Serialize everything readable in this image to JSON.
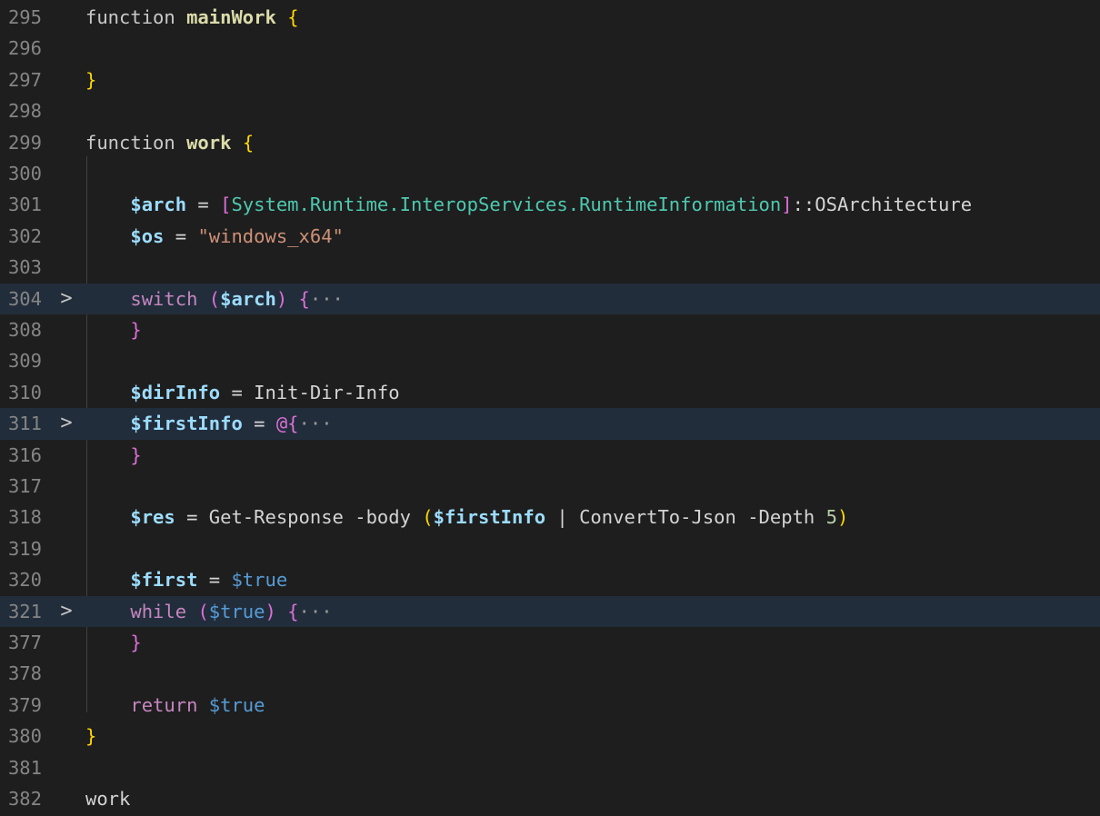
{
  "editor": {
    "lines": [
      {
        "num": "295",
        "fold": false,
        "hl": false,
        "tokens": [
          {
            "t": "function ",
            "c": "fn-kw"
          },
          {
            "t": "mainWork",
            "c": "fn"
          },
          {
            "t": " ",
            "c": "plain"
          },
          {
            "t": "{",
            "c": "brace1"
          }
        ]
      },
      {
        "num": "296",
        "fold": false,
        "hl": false,
        "tokens": []
      },
      {
        "num": "297",
        "fold": false,
        "hl": false,
        "tokens": [
          {
            "t": "}",
            "c": "brace1"
          }
        ]
      },
      {
        "num": "298",
        "fold": false,
        "hl": false,
        "tokens": []
      },
      {
        "num": "299",
        "fold": false,
        "hl": false,
        "tokens": [
          {
            "t": "function ",
            "c": "fn-kw"
          },
          {
            "t": "work",
            "c": "fn"
          },
          {
            "t": " ",
            "c": "plain"
          },
          {
            "t": "{",
            "c": "brace1"
          }
        ]
      },
      {
        "num": "300",
        "fold": false,
        "hl": false,
        "tokens": []
      },
      {
        "num": "301",
        "fold": false,
        "hl": false,
        "tokens": [
          {
            "t": "    ",
            "c": "plain"
          },
          {
            "t": "$arch",
            "c": "var"
          },
          {
            "t": " = ",
            "c": "plain"
          },
          {
            "t": "[",
            "c": "brace2"
          },
          {
            "t": "System.Runtime.InteropServices.RuntimeInformation",
            "c": "type"
          },
          {
            "t": "]",
            "c": "brace2"
          },
          {
            "t": "::OSArchitecture",
            "c": "plain"
          }
        ]
      },
      {
        "num": "302",
        "fold": false,
        "hl": false,
        "tokens": [
          {
            "t": "    ",
            "c": "plain"
          },
          {
            "t": "$os",
            "c": "var"
          },
          {
            "t": " = ",
            "c": "plain"
          },
          {
            "t": "\"windows_x64\"",
            "c": "str"
          }
        ]
      },
      {
        "num": "303",
        "fold": false,
        "hl": false,
        "tokens": []
      },
      {
        "num": "304",
        "fold": true,
        "hl": true,
        "tokens": [
          {
            "t": "    ",
            "c": "plain"
          },
          {
            "t": "switch",
            "c": "kw"
          },
          {
            "t": " ",
            "c": "plain"
          },
          {
            "t": "(",
            "c": "brace2"
          },
          {
            "t": "$arch",
            "c": "var"
          },
          {
            "t": ")",
            "c": "brace2"
          },
          {
            "t": " ",
            "c": "plain"
          },
          {
            "t": "{",
            "c": "brace2"
          },
          {
            "t": "···",
            "c": "ellip"
          }
        ]
      },
      {
        "num": "308",
        "fold": false,
        "hl": false,
        "tokens": [
          {
            "t": "    ",
            "c": "plain"
          },
          {
            "t": "}",
            "c": "brace2"
          }
        ]
      },
      {
        "num": "309",
        "fold": false,
        "hl": false,
        "tokens": []
      },
      {
        "num": "310",
        "fold": false,
        "hl": false,
        "tokens": [
          {
            "t": "    ",
            "c": "plain"
          },
          {
            "t": "$dirInfo",
            "c": "var"
          },
          {
            "t": " = Init-Dir-Info",
            "c": "plain"
          }
        ]
      },
      {
        "num": "311",
        "fold": true,
        "hl": true,
        "tokens": [
          {
            "t": "    ",
            "c": "plain"
          },
          {
            "t": "$firstInfo",
            "c": "var"
          },
          {
            "t": " = ",
            "c": "plain"
          },
          {
            "t": "@{",
            "c": "brace2"
          },
          {
            "t": "···",
            "c": "ellip"
          }
        ]
      },
      {
        "num": "316",
        "fold": false,
        "hl": false,
        "tokens": [
          {
            "t": "    ",
            "c": "plain"
          },
          {
            "t": "}",
            "c": "brace2"
          }
        ]
      },
      {
        "num": "317",
        "fold": false,
        "hl": false,
        "tokens": []
      },
      {
        "num": "318",
        "fold": false,
        "hl": false,
        "tokens": [
          {
            "t": "    ",
            "c": "plain"
          },
          {
            "t": "$res",
            "c": "var"
          },
          {
            "t": " = Get-Response -body ",
            "c": "plain"
          },
          {
            "t": "(",
            "c": "brace1"
          },
          {
            "t": "$firstInfo",
            "c": "var"
          },
          {
            "t": " | ConvertTo-Json -Depth ",
            "c": "plain"
          },
          {
            "t": "5",
            "c": "num"
          },
          {
            "t": ")",
            "c": "brace1"
          }
        ]
      },
      {
        "num": "319",
        "fold": false,
        "hl": false,
        "tokens": []
      },
      {
        "num": "320",
        "fold": false,
        "hl": false,
        "tokens": [
          {
            "t": "    ",
            "c": "plain"
          },
          {
            "t": "$first",
            "c": "var"
          },
          {
            "t": " = ",
            "c": "plain"
          },
          {
            "t": "$true",
            "c": "auto"
          }
        ]
      },
      {
        "num": "321",
        "fold": true,
        "hl": true,
        "tokens": [
          {
            "t": "    ",
            "c": "plain"
          },
          {
            "t": "while",
            "c": "kw"
          },
          {
            "t": " ",
            "c": "plain"
          },
          {
            "t": "(",
            "c": "brace2"
          },
          {
            "t": "$true",
            "c": "auto"
          },
          {
            "t": ")",
            "c": "brace2"
          },
          {
            "t": " ",
            "c": "plain"
          },
          {
            "t": "{",
            "c": "brace2"
          },
          {
            "t": "···",
            "c": "ellip"
          }
        ]
      },
      {
        "num": "377",
        "fold": false,
        "hl": false,
        "tokens": [
          {
            "t": "    ",
            "c": "plain"
          },
          {
            "t": "}",
            "c": "brace2"
          }
        ]
      },
      {
        "num": "378",
        "fold": false,
        "hl": false,
        "tokens": []
      },
      {
        "num": "379",
        "fold": false,
        "hl": false,
        "tokens": [
          {
            "t": "    ",
            "c": "plain"
          },
          {
            "t": "return",
            "c": "kw"
          },
          {
            "t": " ",
            "c": "plain"
          },
          {
            "t": "$true",
            "c": "auto"
          }
        ]
      },
      {
        "num": "380",
        "fold": false,
        "hl": false,
        "tokens": [
          {
            "t": "}",
            "c": "brace1"
          }
        ]
      },
      {
        "num": "381",
        "fold": false,
        "hl": false,
        "tokens": []
      },
      {
        "num": "382",
        "fold": false,
        "hl": false,
        "tokens": [
          {
            "t": "work",
            "c": "plain"
          }
        ]
      }
    ],
    "fold_icon": "chevron-right-icon",
    "fold_glyph": ">"
  }
}
